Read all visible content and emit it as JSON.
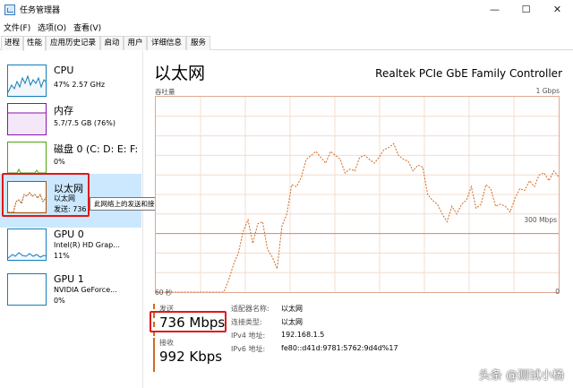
{
  "window": {
    "title": "任务管理器",
    "minimize": "—",
    "maximize": "☐",
    "close": "✕"
  },
  "menu": [
    "文件(F)",
    "选项(O)",
    "查看(V)"
  ],
  "tabs": [
    "进程",
    "性能",
    "应用历史记录",
    "启动",
    "用户",
    "详细信息",
    "服务"
  ],
  "active_tab": "性能",
  "sidebar": {
    "cpu": {
      "title": "CPU",
      "sub": "47% 2.57 GHz",
      "color": "#117dbb"
    },
    "memory": {
      "title": "内存",
      "sub": "5.7/7.5 GB (76%)",
      "color": "#8b12ae"
    },
    "disk": {
      "title": "磁盘 0 (C: D: E: F:",
      "sub": "0%",
      "color": "#4da60c"
    },
    "ethernet": {
      "title": "以太网",
      "sub1": "以太网",
      "sub2": "发送: 736",
      "color": "#a74f01"
    },
    "gpu0": {
      "title": "GPU 0",
      "sub1": "Intel(R) HD Grap...",
      "sub2": "11%",
      "color": "#117dbb"
    },
    "gpu1": {
      "title": "GPU 1",
      "sub1": "NVIDIA GeForce...",
      "sub2": "0%",
      "color": "#117dbb"
    }
  },
  "tooltip": "此网络上的发送和接收活动",
  "main": {
    "title": "以太网",
    "adapter": "Realtek PCIe GbE Family Controller",
    "throughput_label": "吞吐量",
    "max_label": "1 Gbps",
    "mid_label": "300 Mbps",
    "time_label": "60 秒",
    "zero_label": "0",
    "send_label": "发送",
    "send_value": "736 Mbps",
    "recv_label": "接收",
    "recv_value": "992 Kbps",
    "info": [
      {
        "key": "适配器名称:",
        "value": "以太网"
      },
      {
        "key": "连接类型:",
        "value": "以太网"
      },
      {
        "key": "IPv4 地址:",
        "value": "192.168.1.5"
      },
      {
        "key": "IPv6 地址:",
        "value": "fe80::d41d:9781:5762:9d4d%17"
      }
    ]
  },
  "colors": {
    "accent": "#d2691e",
    "highlight": "#e01818",
    "selected": "#cce8ff"
  },
  "chart_data": {
    "type": "line",
    "xlabel": "60 秒",
    "ylabel": "吞吐量",
    "ylim": [
      0,
      1000
    ],
    "ymax_label": "1 Gbps",
    "reference_line": 300,
    "series": [
      {
        "name": "发送",
        "style": "dashed",
        "values": [
          0,
          0,
          0,
          0,
          0,
          0,
          0,
          0,
          0,
          0,
          0,
          0,
          0,
          0,
          0,
          60,
          140,
          200,
          310,
          370,
          250,
          350,
          360,
          220,
          180,
          120,
          340,
          400,
          550,
          540,
          590,
          680,
          700,
          720,
          690,
          660,
          720,
          700,
          680,
          610,
          630,
          620,
          690,
          700,
          680,
          660,
          690,
          730,
          740,
          760,
          700,
          680,
          670,
          620,
          650,
          640,
          500,
          470,
          450,
          400,
          360,
          440,
          400,
          450,
          470,
          540,
          430,
          450,
          550,
          530,
          440,
          450,
          440,
          410,
          480,
          530,
          520,
          570,
          540,
          600,
          610,
          570,
          620,
          590
        ]
      }
    ]
  },
  "watermark": "头条 @测试小杨"
}
